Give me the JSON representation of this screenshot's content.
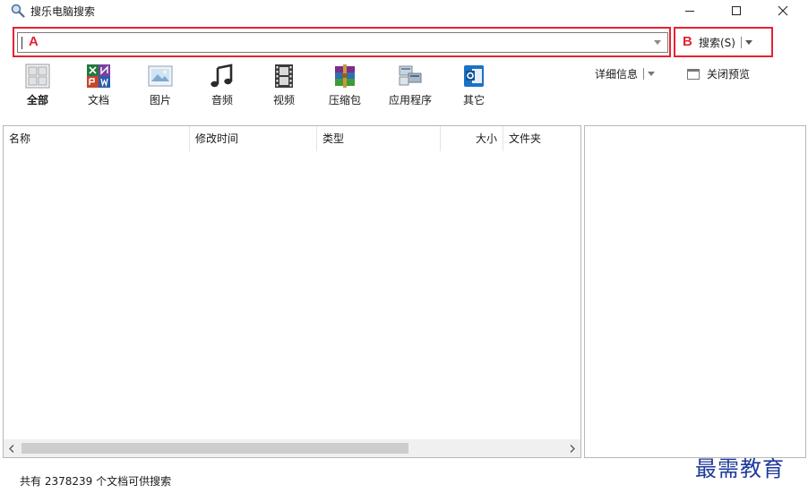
{
  "window": {
    "title": "搜乐电脑搜索",
    "icons": {
      "app": "magnifier-icon",
      "minimize": "minimize-icon",
      "maximize": "maximize-icon",
      "close": "close-icon"
    }
  },
  "search": {
    "value": "",
    "placeholder": "",
    "callout_a": "A",
    "callout_b": "B",
    "button_label": "搜索(S)",
    "highlight_color": "#e52332"
  },
  "categories": [
    {
      "label": "全部",
      "icon": "grid-all-icon",
      "selected": true
    },
    {
      "label": "文档",
      "icon": "document-icon",
      "selected": false
    },
    {
      "label": "图片",
      "icon": "picture-icon",
      "selected": false
    },
    {
      "label": "音频",
      "icon": "music-note-icon",
      "selected": false
    },
    {
      "label": "视频",
      "icon": "film-icon",
      "selected": false
    },
    {
      "label": "压缩包",
      "icon": "archive-icon",
      "selected": false
    },
    {
      "label": "应用程序",
      "icon": "application-icon",
      "selected": false
    },
    {
      "label": "其它",
      "icon": "other-file-icon",
      "selected": false
    }
  ],
  "toolbar": {
    "details_label": "详细信息",
    "close_preview_label": "关闭预览"
  },
  "table": {
    "columns": [
      "名称",
      "修改时间",
      "类型",
      "大小",
      "文件夹"
    ],
    "rows": []
  },
  "status": {
    "text": "共有 2378239 个文档可供搜索"
  },
  "watermark": "最需教育"
}
